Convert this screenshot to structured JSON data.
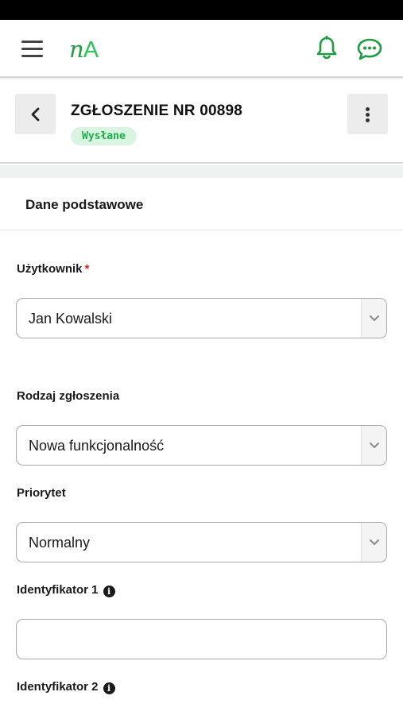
{
  "app": {
    "logo_text_lower": "n",
    "logo_text_upper": "A",
    "brand_color": "#1e9c3f"
  },
  "icons": {
    "menu": "hamburger-menu-icon",
    "notifications": "bell-icon",
    "messages": "chat-bubble-icon",
    "back": "chevron-left-icon",
    "more": "vertical-dots-icon",
    "dropdown": "chevron-down-icon",
    "info": "info-circle-icon"
  },
  "ticket": {
    "title": "ZGŁOSZENIE NR 00898",
    "status": "Wysłane",
    "status_color": "#1db04a",
    "status_bg": "#d9f5e1"
  },
  "section": {
    "title": "Dane podstawowe"
  },
  "form": {
    "user": {
      "label": "Użytkownik",
      "required_mark": "*",
      "value": "Jan Kowalski"
    },
    "request_type": {
      "label": "Rodzaj zgłoszenia",
      "value": "Nowa funkcjonalność"
    },
    "priority": {
      "label": "Priorytet",
      "value": "Normalny"
    },
    "identifier1": {
      "label": "Identyfikator 1",
      "value": ""
    },
    "identifier2": {
      "label": "Identyfikator 2"
    }
  }
}
